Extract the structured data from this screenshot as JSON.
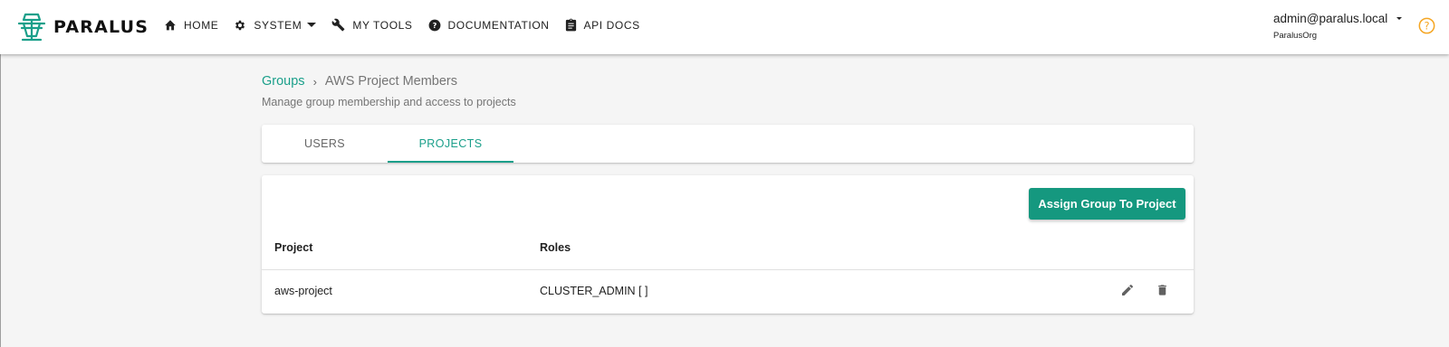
{
  "brand": {
    "name": "PARALUS",
    "accent": "#1a9f8a"
  },
  "nav": {
    "home": {
      "label": "HOME",
      "icon": "home-icon"
    },
    "system": {
      "label": "SYSTEM",
      "icon": "gear-icon"
    },
    "tools": {
      "label": "MY TOOLS",
      "icon": "wrench-icon"
    },
    "docs": {
      "label": "DOCUMENTATION",
      "icon": "help-circle-icon"
    },
    "api": {
      "label": "API DOCS",
      "icon": "clipboard-icon"
    }
  },
  "user": {
    "email": "admin@paralus.local",
    "org": "ParalusOrg"
  },
  "breadcrumb": {
    "parent": "Groups",
    "separator": "›",
    "current": "AWS Project Members"
  },
  "page": {
    "subtitle": "Manage group membership and access to projects"
  },
  "tabs": [
    {
      "label": "USERS",
      "active": false
    },
    {
      "label": "PROJECTS",
      "active": true
    }
  ],
  "actions": {
    "assign_label": "Assign Group To Project",
    "button_color": "#15987f"
  },
  "table": {
    "columns": [
      "Project",
      "Roles"
    ],
    "rows": [
      {
        "project": "aws-project",
        "roles": "CLUSTER_ADMIN [ ]"
      }
    ]
  }
}
